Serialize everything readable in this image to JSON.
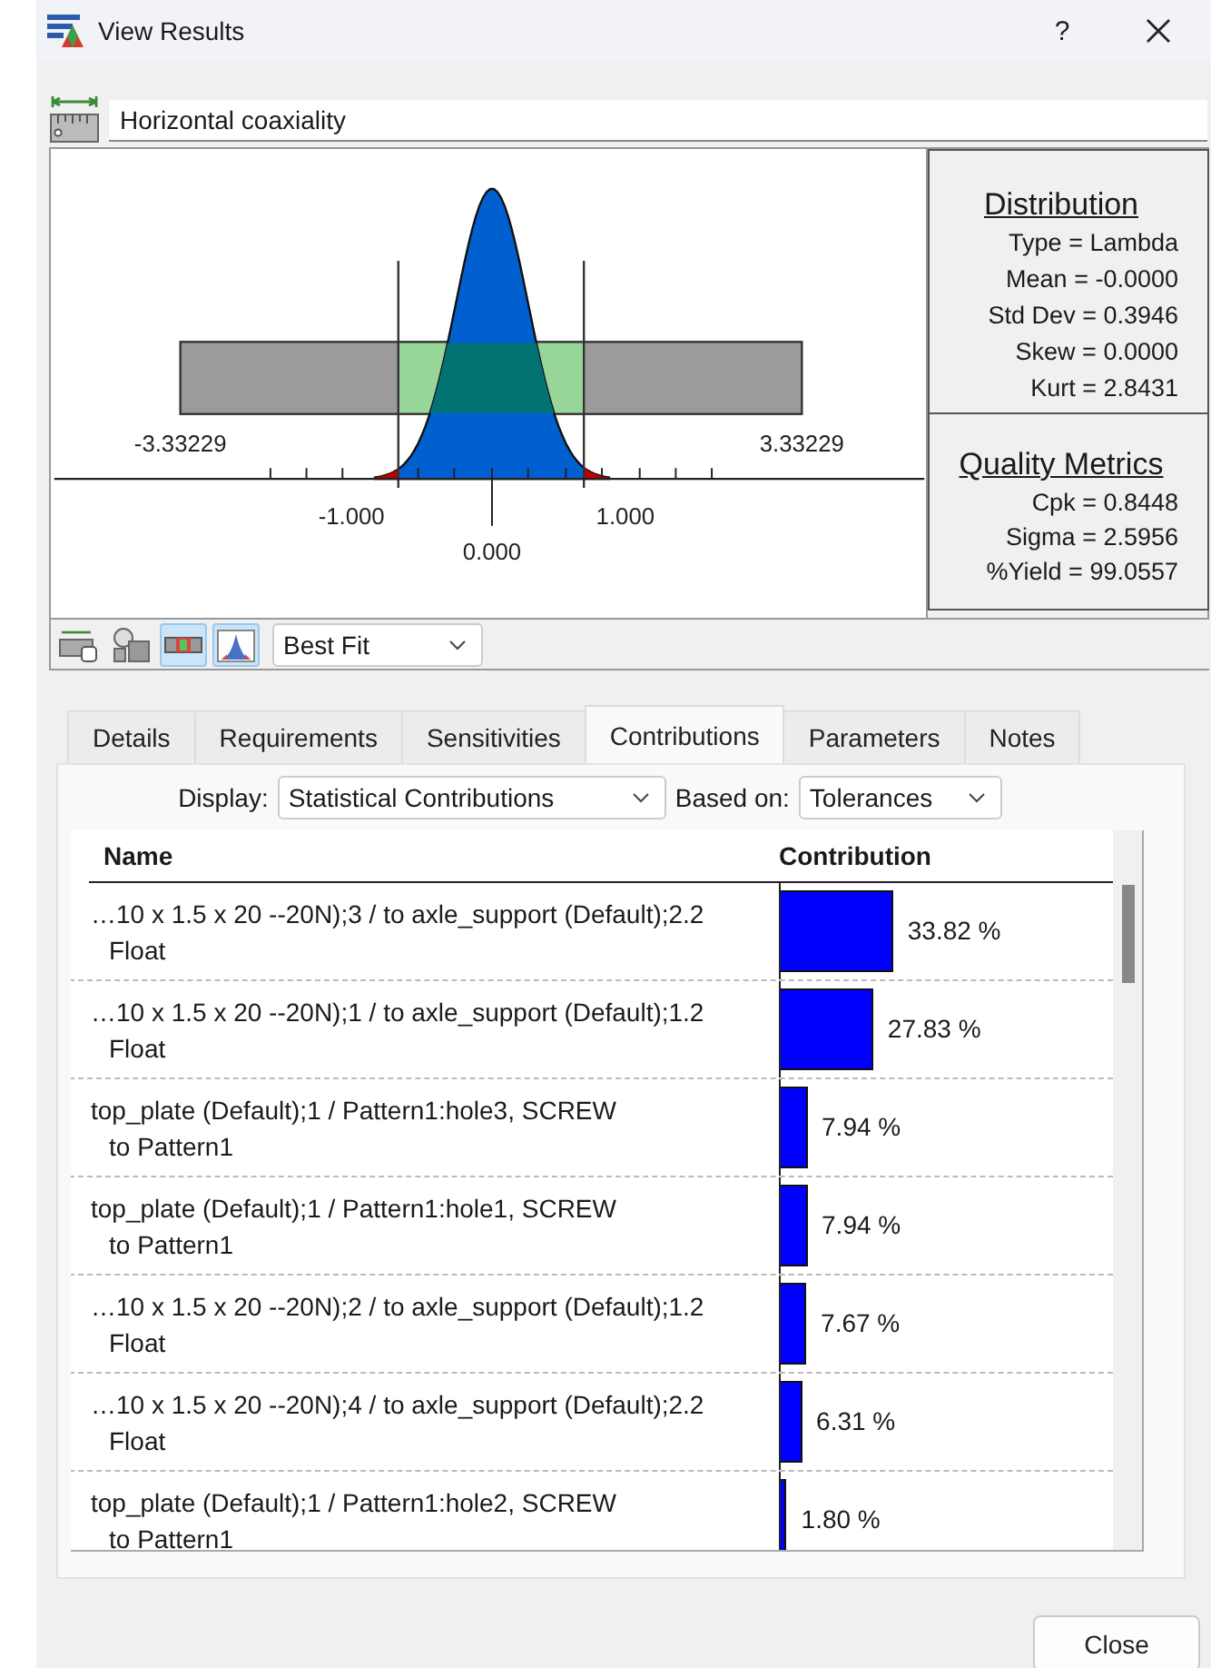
{
  "window": {
    "title": "View Results",
    "help": "?"
  },
  "measurement": {
    "name": "Horizontal coaxiality"
  },
  "plot": {
    "lower_limit": "-3.33229",
    "upper_limit": "3.33229",
    "axis_labels": [
      "-1.000",
      "1.000",
      "0.000"
    ]
  },
  "distribution": {
    "title": "Distribution",
    "lines": [
      "Type = Lambda",
      "Mean = -0.0000",
      "Std Dev = 0.3946",
      "Skew = 0.0000",
      "Kurt = 2.8431"
    ]
  },
  "quality_metrics": {
    "title": "Quality Metrics",
    "lines": [
      "Cpk = 0.8448",
      "Sigma = 2.5956",
      "%Yield = 99.0557"
    ]
  },
  "toolbar": {
    "buttons": [
      {
        "selected": false
      },
      {
        "selected": false
      },
      {
        "selected": true
      },
      {
        "selected": true
      }
    ],
    "fit": "Best Fit"
  },
  "tabs": [
    {
      "label": "Details",
      "selected": false
    },
    {
      "label": "Requirements",
      "selected": false
    },
    {
      "label": "Sensitivities",
      "selected": false
    },
    {
      "label": "Contributions",
      "selected": true
    },
    {
      "label": "Parameters",
      "selected": false
    },
    {
      "label": "Notes",
      "selected": false
    }
  ],
  "display": {
    "label": "Display:",
    "value": "Statistical Contributions"
  },
  "based_on": {
    "label": "Based on:",
    "value": "Tolerances"
  },
  "table": {
    "columns": [
      "Name",
      "Contribution"
    ],
    "rows": [
      {
        "name": [
          "…10 x 1.5 x 20 --20N);3 / to axle_support (Default);2.2",
          "Float"
        ],
        "level": 0.3382,
        "value": "33.82 %"
      },
      {
        "name": [
          "…10 x 1.5 x 20 --20N);1 / to axle_support (Default);1.2",
          "Float"
        ],
        "level": 0.2783,
        "value": "27.83 %"
      },
      {
        "name": [
          "top_plate (Default);1 / Pattern1:hole3, SCREW",
          "to Pattern1"
        ],
        "level": 0.0794,
        "value": "7.94 %"
      },
      {
        "name": [
          "top_plate (Default);1 / Pattern1:hole1, SCREW",
          "to Pattern1"
        ],
        "level": 0.0794,
        "value": "7.94 %"
      },
      {
        "name": [
          "…10 x 1.5 x 20 --20N);2 / to axle_support (Default);1.2",
          "Float"
        ],
        "level": 0.0767,
        "value": "7.67 %"
      },
      {
        "name": [
          "…10 x 1.5 x 20 --20N);4 / to axle_support (Default);2.2",
          "Float"
        ],
        "level": 0.0631,
        "value": "6.31 %"
      },
      {
        "name": [
          "top_plate (Default);1 / Pattern1:hole2, SCREW",
          "to Pattern1"
        ],
        "level": 0.018,
        "value": "1.80 %"
      }
    ]
  },
  "close_button": "Close"
}
